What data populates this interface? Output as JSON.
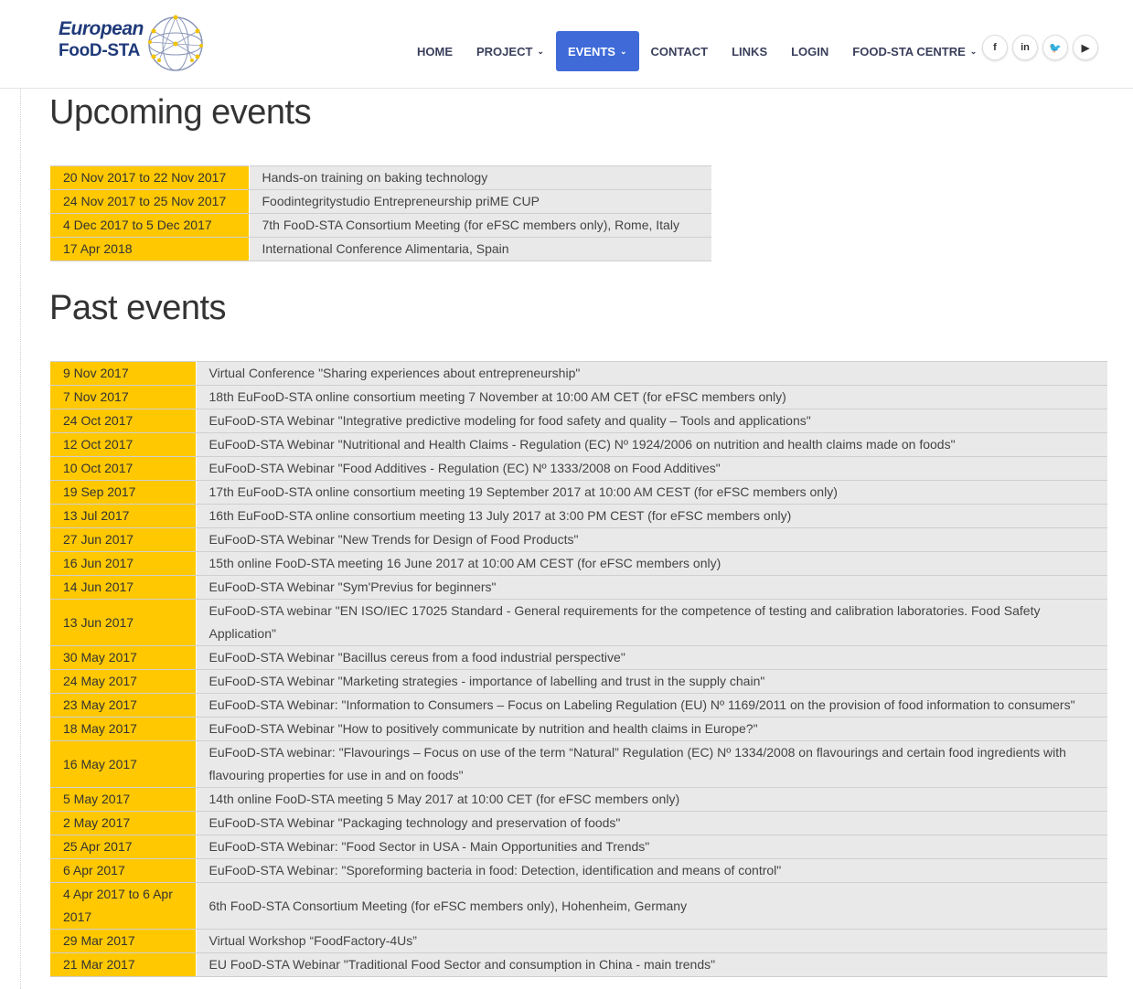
{
  "brand": {
    "line1": "European",
    "line2": "FooD-STA"
  },
  "nav": {
    "items": [
      {
        "label": "HOME",
        "caret": ""
      },
      {
        "label": "PROJECT",
        "caret": "⌄"
      },
      {
        "label": "EVENTS",
        "caret": "⌄"
      },
      {
        "label": "CONTACT",
        "caret": ""
      },
      {
        "label": "LINKS",
        "caret": ""
      },
      {
        "label": "LOGIN",
        "caret": ""
      },
      {
        "label": "FOOD-STA CENTRE",
        "caret": "⌄"
      }
    ],
    "active": "EVENTS",
    "accent": "#3f6ad8"
  },
  "social": [
    {
      "icon": "facebook-icon",
      "glyph": "f"
    },
    {
      "icon": "linkedin-icon",
      "glyph": "in"
    },
    {
      "icon": "twitter-icon",
      "glyph": "🐦"
    },
    {
      "icon": "youtube-icon",
      "glyph": "▶"
    }
  ],
  "upcoming": {
    "heading": "Upcoming events",
    "rows": [
      {
        "date": "20 Nov 2017 to 22 Nov 2017",
        "title": "Hands-on training on baking technology"
      },
      {
        "date": "24 Nov 2017 to 25 Nov 2017",
        "title": "Foodintegritystudio Entrepreneurship priME CUP"
      },
      {
        "date": "4 Dec 2017 to 5 Dec 2017",
        "title": "7th FooD-STA Consortium Meeting (for eFSC members only), Rome, Italy"
      },
      {
        "date": "17 Apr 2018",
        "title": "International Conference Alimentaria, Spain"
      }
    ]
  },
  "past": {
    "heading": "Past events",
    "rows": [
      {
        "date": "9 Nov 2017",
        "title": "Virtual Conference \"Sharing experiences about entrepreneurship\""
      },
      {
        "date": "7 Nov 2017",
        "title": "18th EuFooD-STA online consortium meeting 7 November at 10:00 AM CET (for eFSC members only)"
      },
      {
        "date": "24 Oct 2017",
        "title": "EuFooD-STA Webinar \"Integrative predictive modeling for food safety and quality – Tools and applications\""
      },
      {
        "date": "12 Oct 2017",
        "title": "EuFooD-STA Webinar \"Nutritional and Health Claims - Regulation (EC) Nº 1924/2006 on nutrition and health claims made on foods\""
      },
      {
        "date": "10 Oct 2017",
        "title": "EuFooD-STA Webinar \"Food Additives - Regulation (EC) Nº 1333/2008 on Food Additives\""
      },
      {
        "date": "19 Sep 2017",
        "title": "17th EuFooD-STA online consortium meeting 19 September 2017 at 10:00 AM CEST (for eFSC members only)"
      },
      {
        "date": "13 Jul 2017",
        "title": "16th EuFooD-STA online consortium meeting 13 July 2017 at 3:00 PM CEST (for eFSC members only)"
      },
      {
        "date": "27 Jun 2017",
        "title": "EuFooD-STA Webinar \"New Trends for Design of Food Products\""
      },
      {
        "date": "16 Jun 2017",
        "title": "15th online FooD-STA meeting 16 June 2017 at 10:00 AM CEST (for eFSC members only)"
      },
      {
        "date": "14 Jun 2017",
        "title": "EuFooD-STA Webinar \"Sym'Previus for beginners\""
      },
      {
        "date": "13 Jun 2017",
        "title": "EuFooD-STA webinar \"EN ISO/IEC 17025 Standard - General requirements for the competence of testing and calibration laboratories. Food Safety Application\""
      },
      {
        "date": "30 May 2017",
        "title": "EuFooD-STA Webinar \"Bacillus cereus from a food industrial perspective\""
      },
      {
        "date": "24 May 2017",
        "title": "EuFooD-STA Webinar \"Marketing strategies - importance of labelling and trust in the supply chain\""
      },
      {
        "date": "23 May 2017",
        "title": "EuFooD-STA Webinar: \"Information to Consumers – Focus on Labeling Regulation (EU) Nº 1169/2011 on the provision of food information to consumers\""
      },
      {
        "date": "18 May 2017",
        "title": "EuFooD-STA Webinar \"How to positively communicate by nutrition and health claims in Europe?\""
      },
      {
        "date": "16 May 2017",
        "title": "EuFooD-STA webinar: \"Flavourings – Focus on use of the term “Natural” Regulation (EC) Nº 1334/2008 on flavourings and certain food ingredients with flavouring properties for use in and on foods\""
      },
      {
        "date": "5 May 2017",
        "title": "14th online FooD-STA meeting 5 May 2017 at 10:00 CET (for eFSC members only)"
      },
      {
        "date": "2 May 2017",
        "title": "EuFooD-STA Webinar \"Packaging technology and preservation of foods\""
      },
      {
        "date": "25 Apr 2017",
        "title": "EuFooD-STA Webinar: \"Food Sector in USA - Main Opportunities and Trends\""
      },
      {
        "date": "6 Apr 2017",
        "title": "EuFooD-STA Webinar: \"Sporeforming bacteria in food: Detection, identification and means of control\""
      },
      {
        "date": "4 Apr 2017 to 6 Apr 2017",
        "title": "6th FooD-STA Consortium Meeting (for eFSC members only), Hohenheim, Germany"
      },
      {
        "date": "29 Mar 2017",
        "title": "Virtual Workshop “FoodFactory-4Us”"
      },
      {
        "date": "21 Mar 2017",
        "title": "EU FooD-STA Webinar \"Traditional Food Sector and consumption in China - main trends\""
      }
    ]
  },
  "colors": {
    "date_cell": "#ffc800",
    "title_cell": "#e9e9e9"
  }
}
